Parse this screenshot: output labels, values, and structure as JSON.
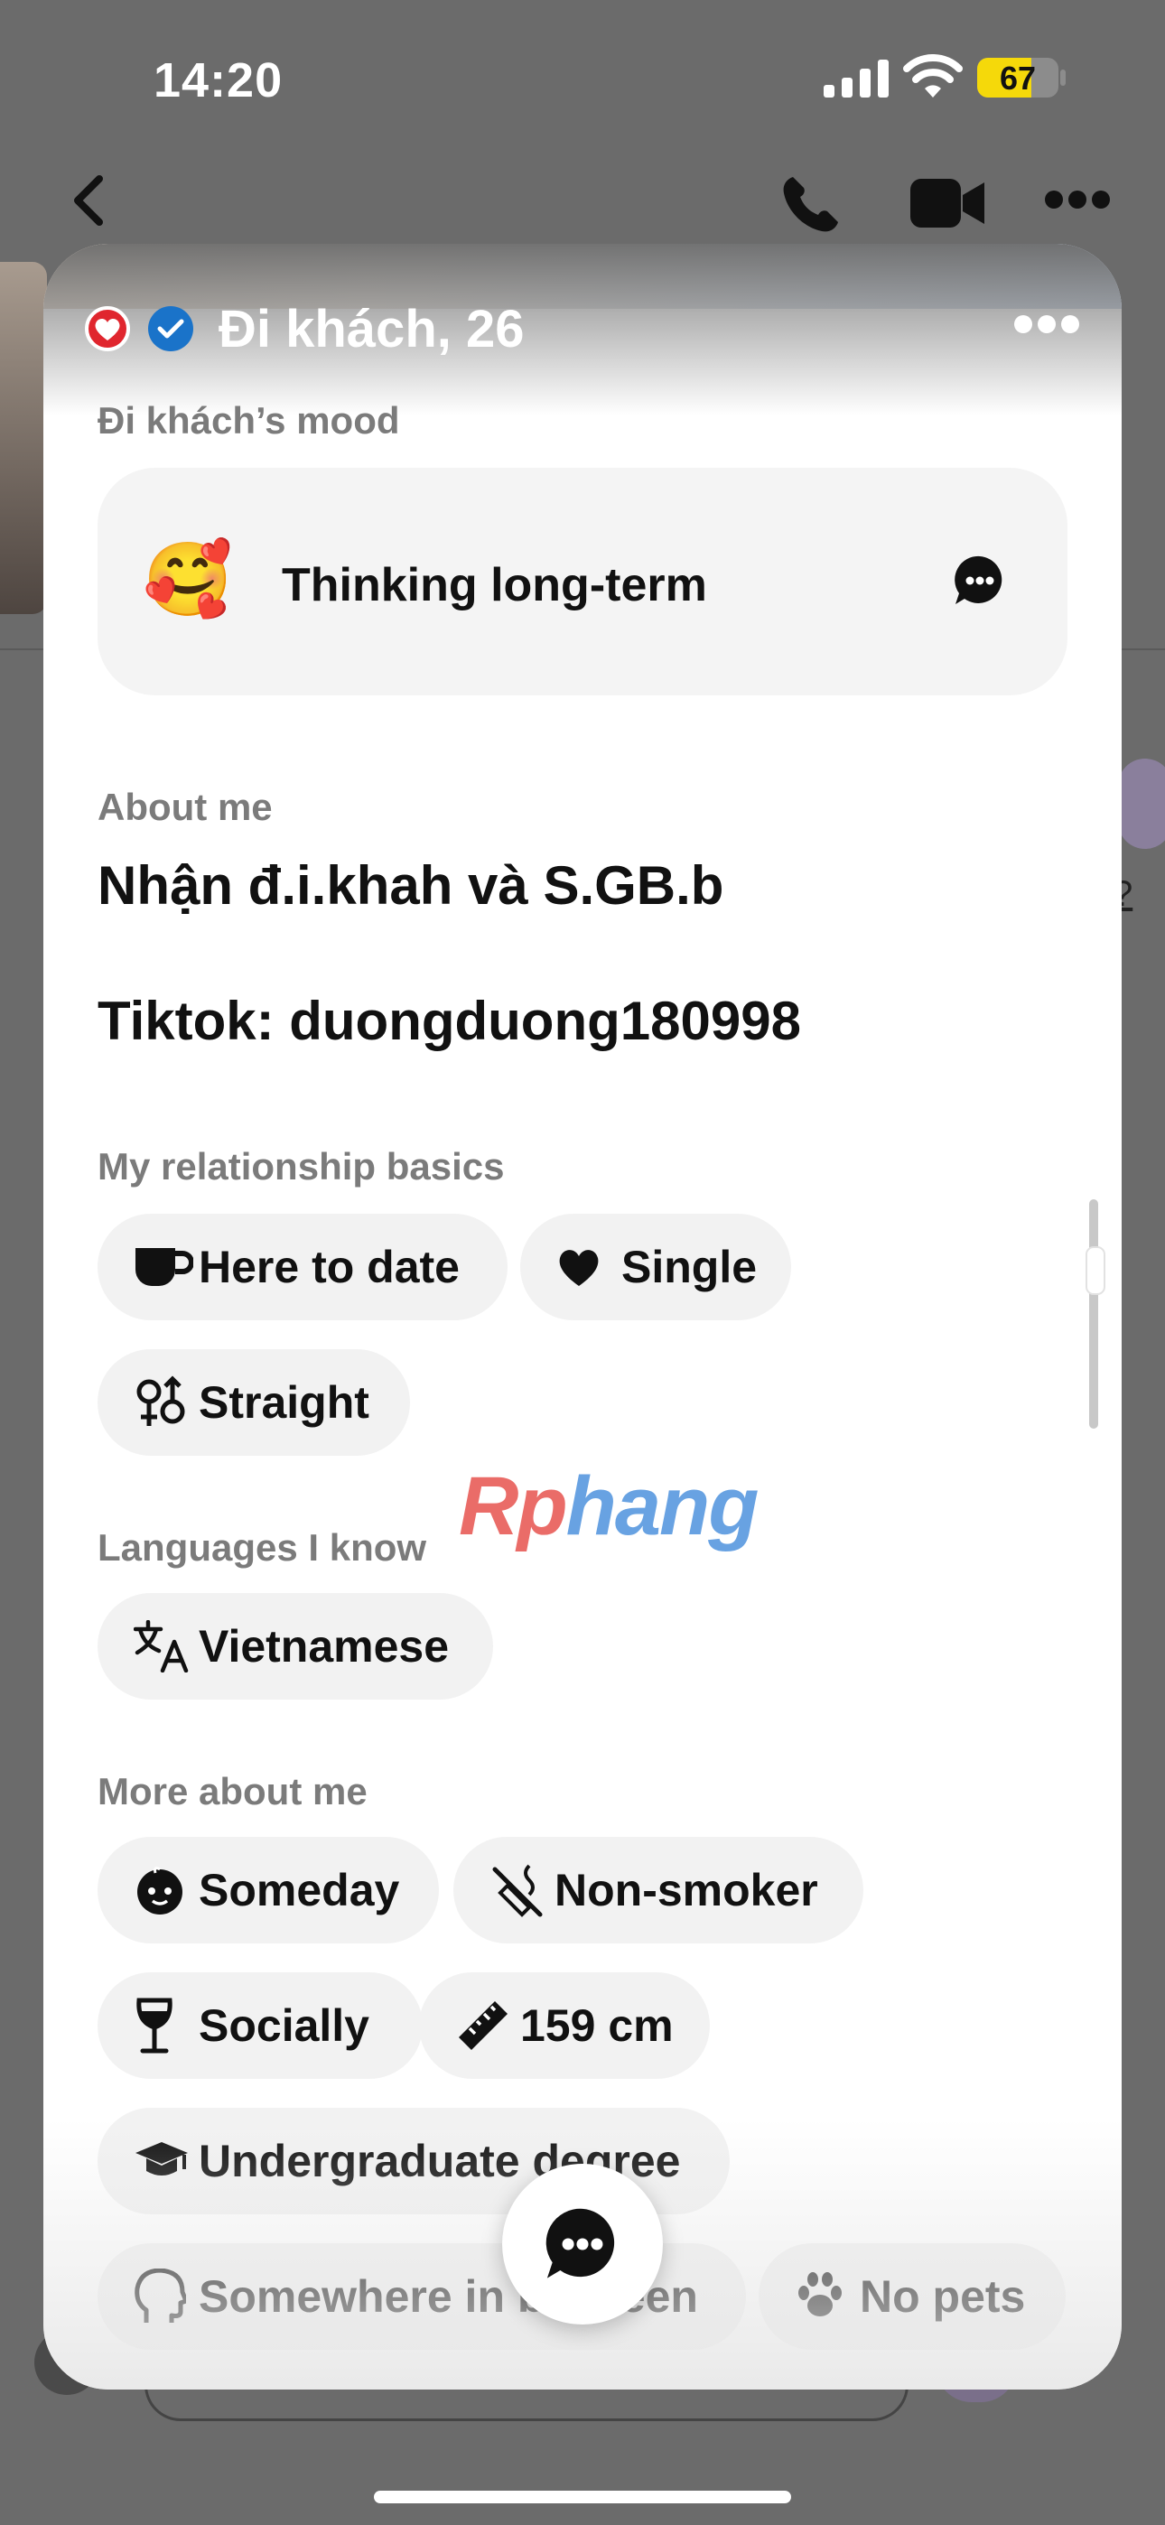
{
  "status_bar": {
    "time": "14:20",
    "battery": "67",
    "battery_level": 0.67
  },
  "chat_header": {
    "back_icon": "chevron-left-icon",
    "call_icon": "phone-icon",
    "video_icon": "video-camera-icon",
    "more_icon": "ellipsis-icon"
  },
  "profile": {
    "name": "Đi khách, 26",
    "badges": [
      "heart-badge-icon",
      "verified-check-icon"
    ]
  },
  "mood": {
    "label": "Đi khách’s mood",
    "emoji": "🥰",
    "text": "Thinking long-term"
  },
  "about": {
    "label": "About me",
    "lines": [
      "Nhận đ.i.khah và S.GB.b",
      "Tiktok: duongduong180998"
    ]
  },
  "relationship": {
    "label": "My relationship basics",
    "chips": [
      "Here to date",
      "Single",
      "Straight"
    ]
  },
  "languages": {
    "label": "Languages I know",
    "chips": [
      "Vietnamese"
    ]
  },
  "more_about": {
    "label": "More about me",
    "chips": [
      "Someday",
      "Non-smoker",
      "Socially",
      "159 cm",
      "Undergraduate degree",
      "Somewhere in between",
      "No pets"
    ]
  },
  "watermark": {
    "part1": "Rp",
    "part2": "hang"
  },
  "colors": {
    "accent_red": "#e0262e",
    "verified_blue": "#1a73c9",
    "chip_bg": "#f2f2f2",
    "label_gray": "#7b7b7b"
  }
}
